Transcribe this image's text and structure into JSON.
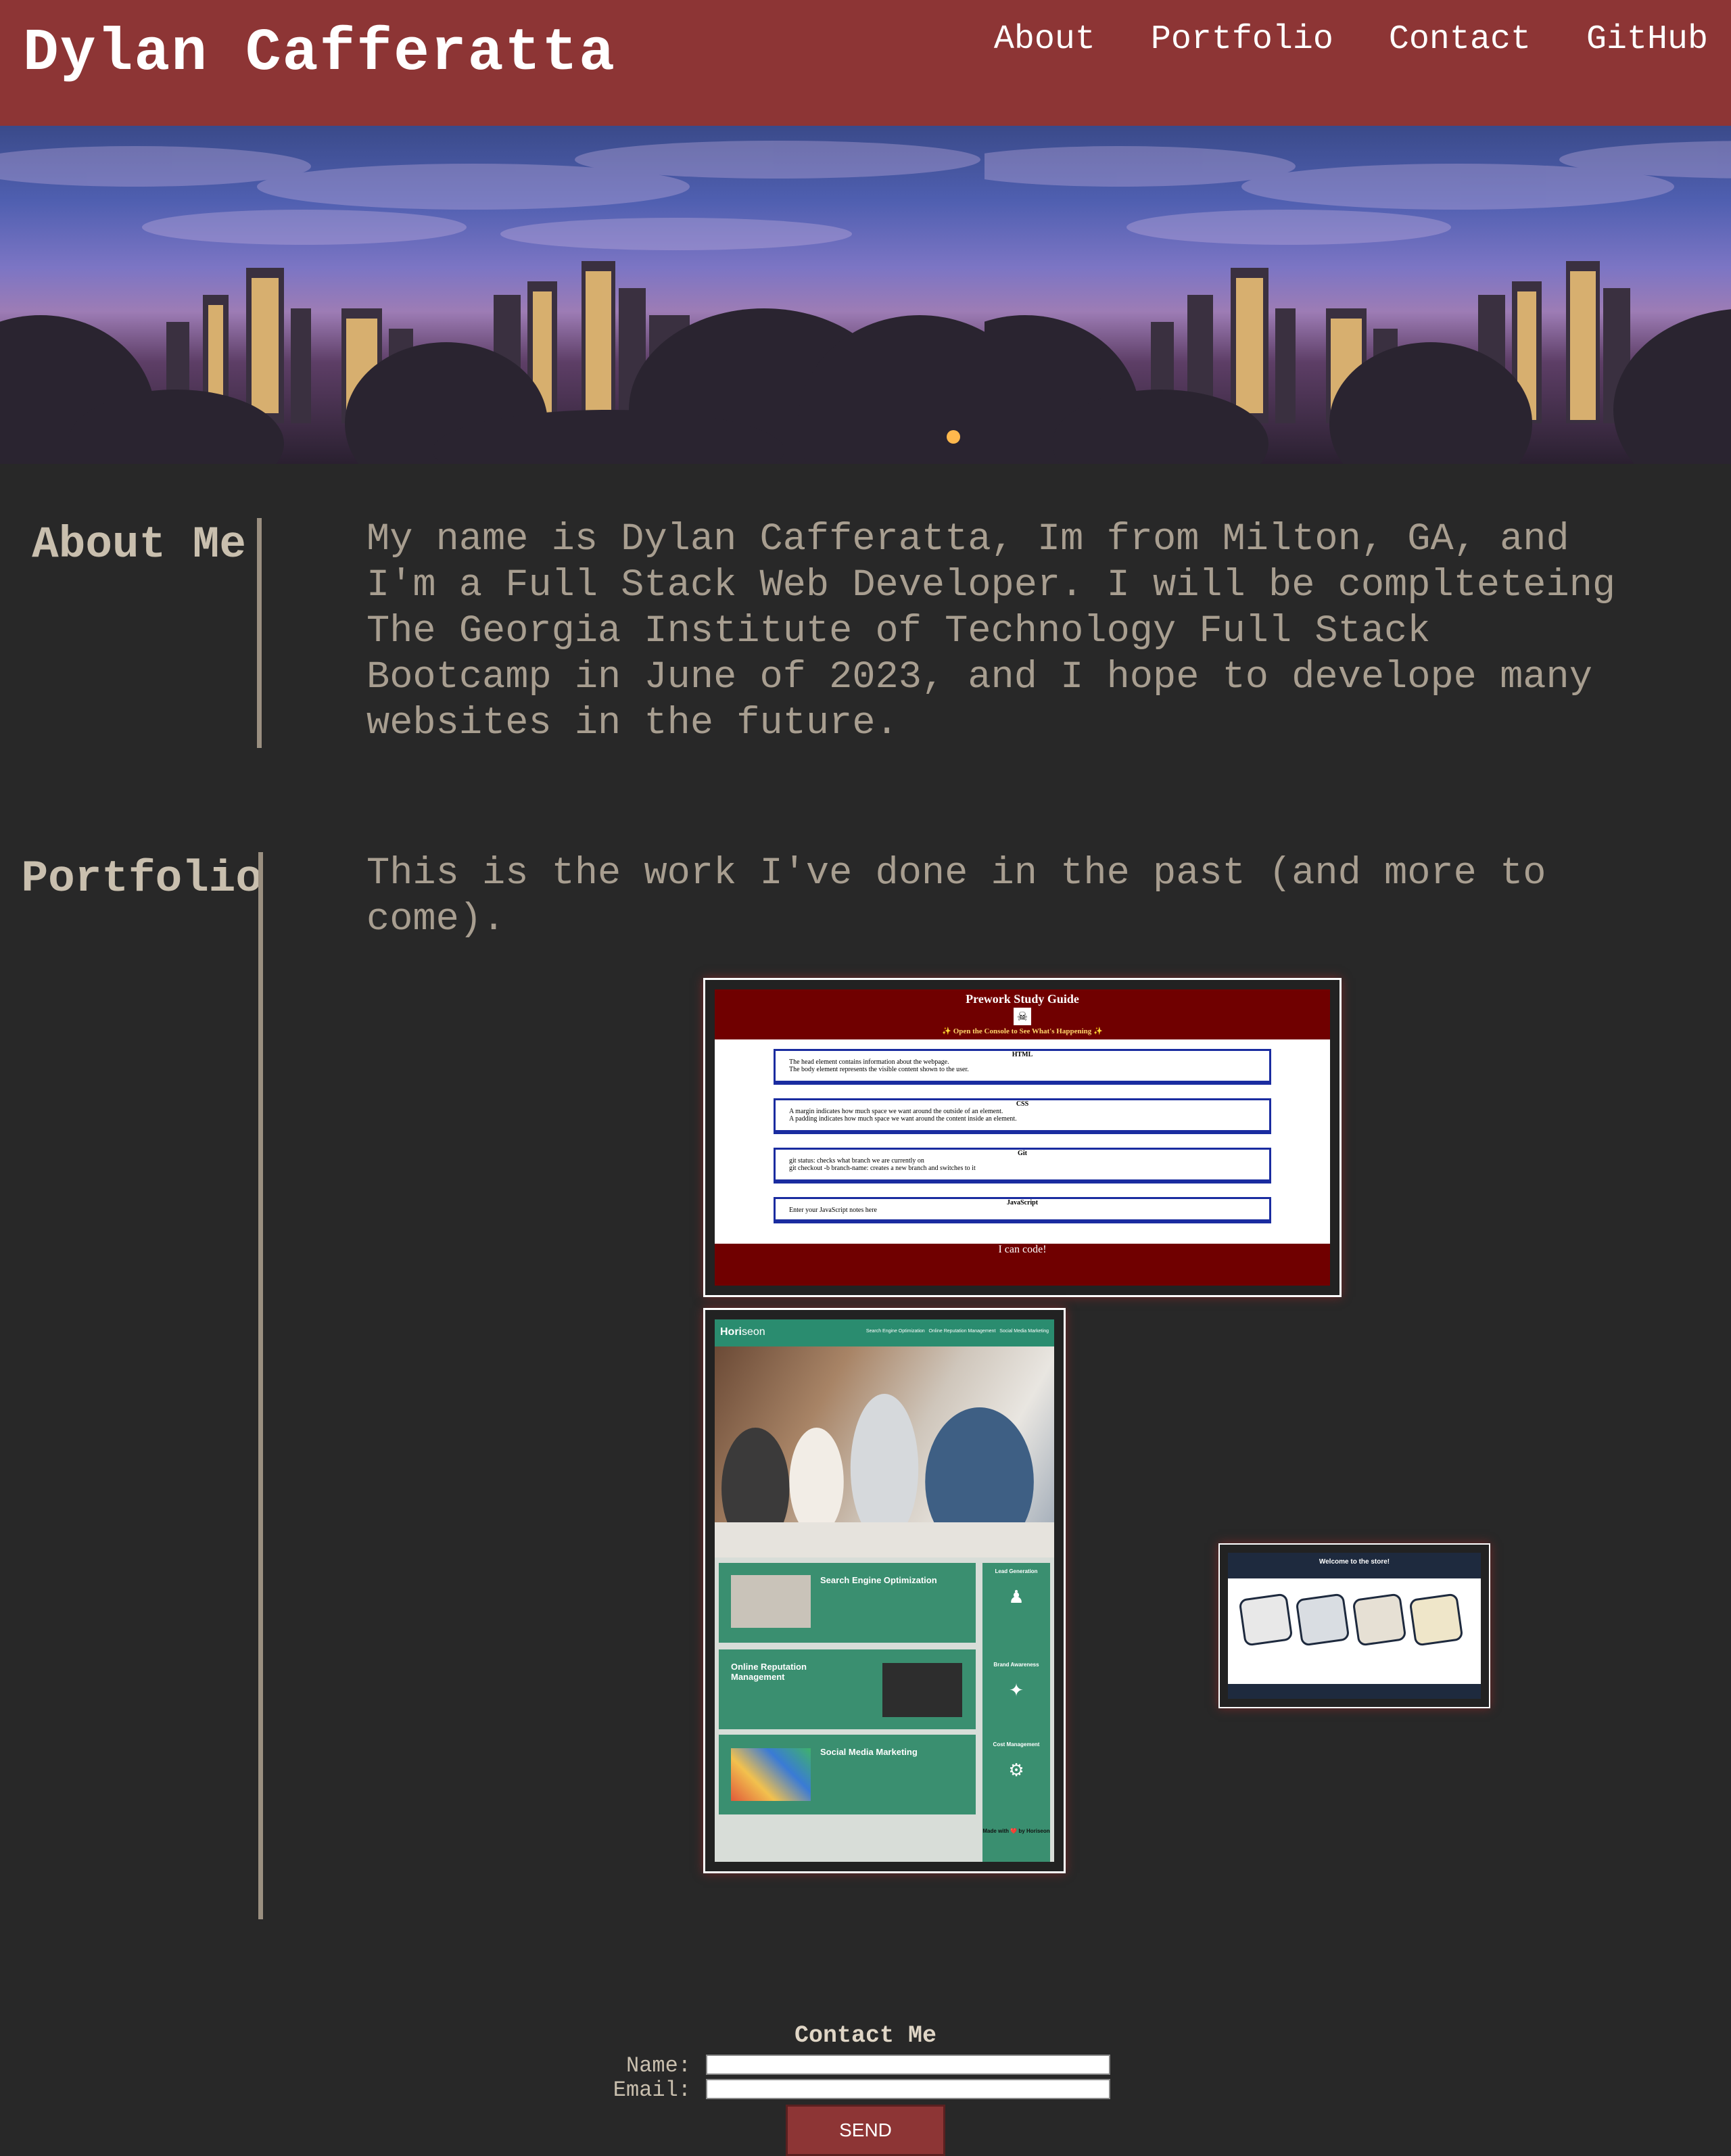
{
  "header": {
    "title": "Dylan Cafferatta",
    "nav": [
      "About",
      "Portfolio",
      "Contact",
      "GitHub"
    ]
  },
  "about": {
    "title": "About Me",
    "text": "My name is Dylan Cafferatta, Im from Milton, GA, and I'm a Full Stack Web Developer. I will be complteteing The Georgia Institute of Technology Full Stack Bootcamp in June of 2023, and I hope to develope many websites in the future."
  },
  "portfolio": {
    "title": "Portfolio",
    "intro": "This is the work I've done in the past (and more to come).",
    "prework": {
      "title": "Prework Study Guide",
      "subtitle": "✨ Open the Console to See What's Happening ✨",
      "cards": [
        {
          "heading": "HTML",
          "items": [
            "The head element contains information about the webpage.",
            "The body element represents the visible content shown to the user."
          ]
        },
        {
          "heading": "CSS",
          "items": [
            "A margin indicates how much space we want around the outside of an element.",
            "A padding indicates how much space we want around the content inside an element."
          ]
        },
        {
          "heading": "Git",
          "items": [
            "git status: checks what branch we are currently on",
            "git checkout -b branch-name: creates a new branch and switches to it"
          ]
        },
        {
          "heading": "JavaScript",
          "items": [
            "Enter your JavaScript notes here"
          ]
        }
      ],
      "footer": "I can code!"
    },
    "horiseon": {
      "brand_a": "Hori",
      "brand_b": "seon",
      "nav": [
        "Search Engine Optimization",
        "Online Reputation Management",
        "Social Media Marketing"
      ],
      "cards": [
        "Search Engine Optimization",
        "Online Reputation Management",
        "Social Media Marketing"
      ],
      "side": [
        "Lead Generation",
        "Brand Awareness",
        "Cost Management"
      ],
      "footer": "Made with ❤️ by Horiseon"
    },
    "store": {
      "title": "Welcome to the store!"
    }
  },
  "contact": {
    "title": "Contact Me",
    "name_label": "Name:",
    "email_label": "Email:",
    "name_value": "",
    "email_value": "",
    "send": "SEND"
  }
}
